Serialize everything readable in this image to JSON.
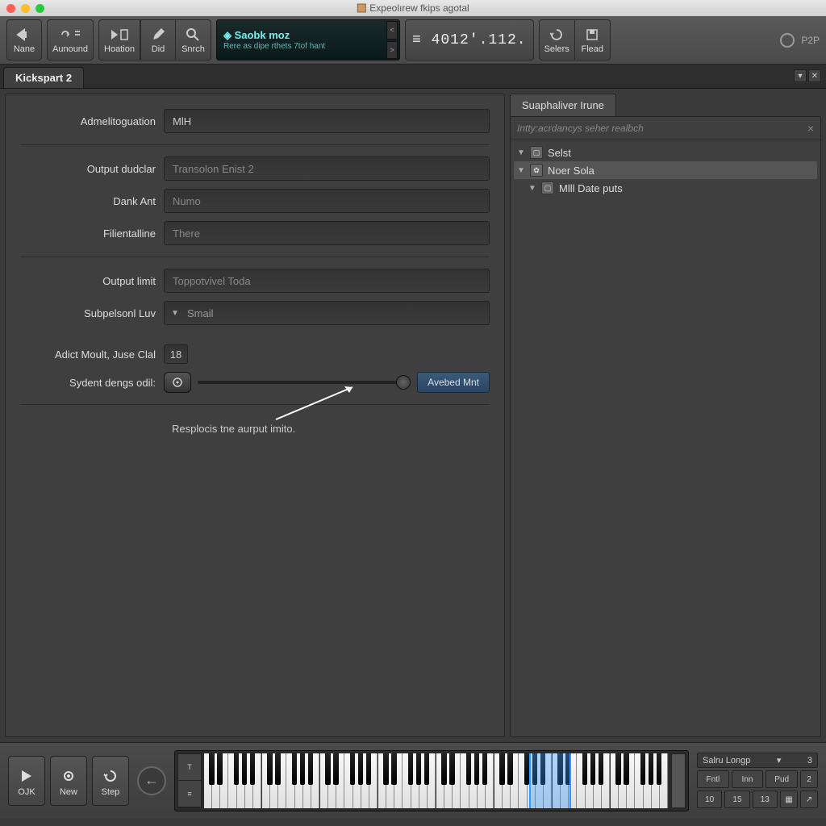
{
  "window": {
    "title": "Expeolırew fkips agotal"
  },
  "toolbar": {
    "left": [
      {
        "name": "name-button",
        "label": "Nane",
        "icon": "rewind"
      },
      {
        "name": "aunound-button",
        "label": "Aunound",
        "icon": "loop"
      },
      {
        "name": "hoation-button",
        "label": "Hoation",
        "icon": "play-doc"
      },
      {
        "name": "did-button",
        "label": "Did",
        "icon": "pencil"
      },
      {
        "name": "snrch-button",
        "label": "Snrch",
        "icon": "search"
      }
    ],
    "lcd": {
      "line1": "◈ Saobk moz",
      "line2": "Rere as dipe rthets 7tof hant"
    },
    "counter": "≡ 4012'.112.",
    "right": [
      {
        "name": "selers-button",
        "label": "Selers",
        "icon": "refresh"
      },
      {
        "name": "flead-button",
        "label": "Flead",
        "icon": "save"
      }
    ],
    "p2p": "P2P"
  },
  "tabs": {
    "main": "Kickspart 2"
  },
  "form": {
    "admel_label": "Admelitoguation",
    "admel_value": "MlH",
    "output_dud_label": "Output dudclar",
    "output_dud_ph": "Transolon Enist 2",
    "dank_label": "Dank Ant",
    "dank_ph": "Numo",
    "filent_label": "Filientalline",
    "filent_ph": "There",
    "output_limit_label": "Output limit",
    "output_limit_ph": "Toppotvivel Toda",
    "subpel_label": "Subpelsonl Luv",
    "subpel_val": "Smail",
    "adict_label": "Adict Moult, Juse Clal",
    "adict_val": "18",
    "sydent_label": "Sydent dengs odil:",
    "action_btn": "Avebed Mnt",
    "hint": "Resplocis tne aurput imito."
  },
  "rightPanel": {
    "tab": "Suaphaliver Irune",
    "search_ph": "Intty:acrdancys seher realbch",
    "tree": [
      {
        "label": "Selst",
        "depth": 0,
        "icon": "box"
      },
      {
        "label": "Noer Sola",
        "depth": 0,
        "icon": "gear",
        "sel": true
      },
      {
        "label": "Mlll Date puts",
        "depth": 1,
        "icon": "box"
      }
    ]
  },
  "bottom": {
    "buttons": [
      {
        "name": "ojk-button",
        "label": "OJK",
        "icon": "play"
      },
      {
        "name": "new-button",
        "label": "New",
        "icon": "gear"
      },
      {
        "name": "step-button",
        "label": "Step",
        "icon": "refresh"
      }
    ],
    "right": {
      "loop_label": "Salru Longp",
      "loop_caret": "▾",
      "loop_val": "3",
      "mid": [
        "Fntl",
        "Inn",
        "Pud"
      ],
      "mid_end": "2",
      "bot": [
        "10",
        "15",
        "13"
      ]
    }
  }
}
